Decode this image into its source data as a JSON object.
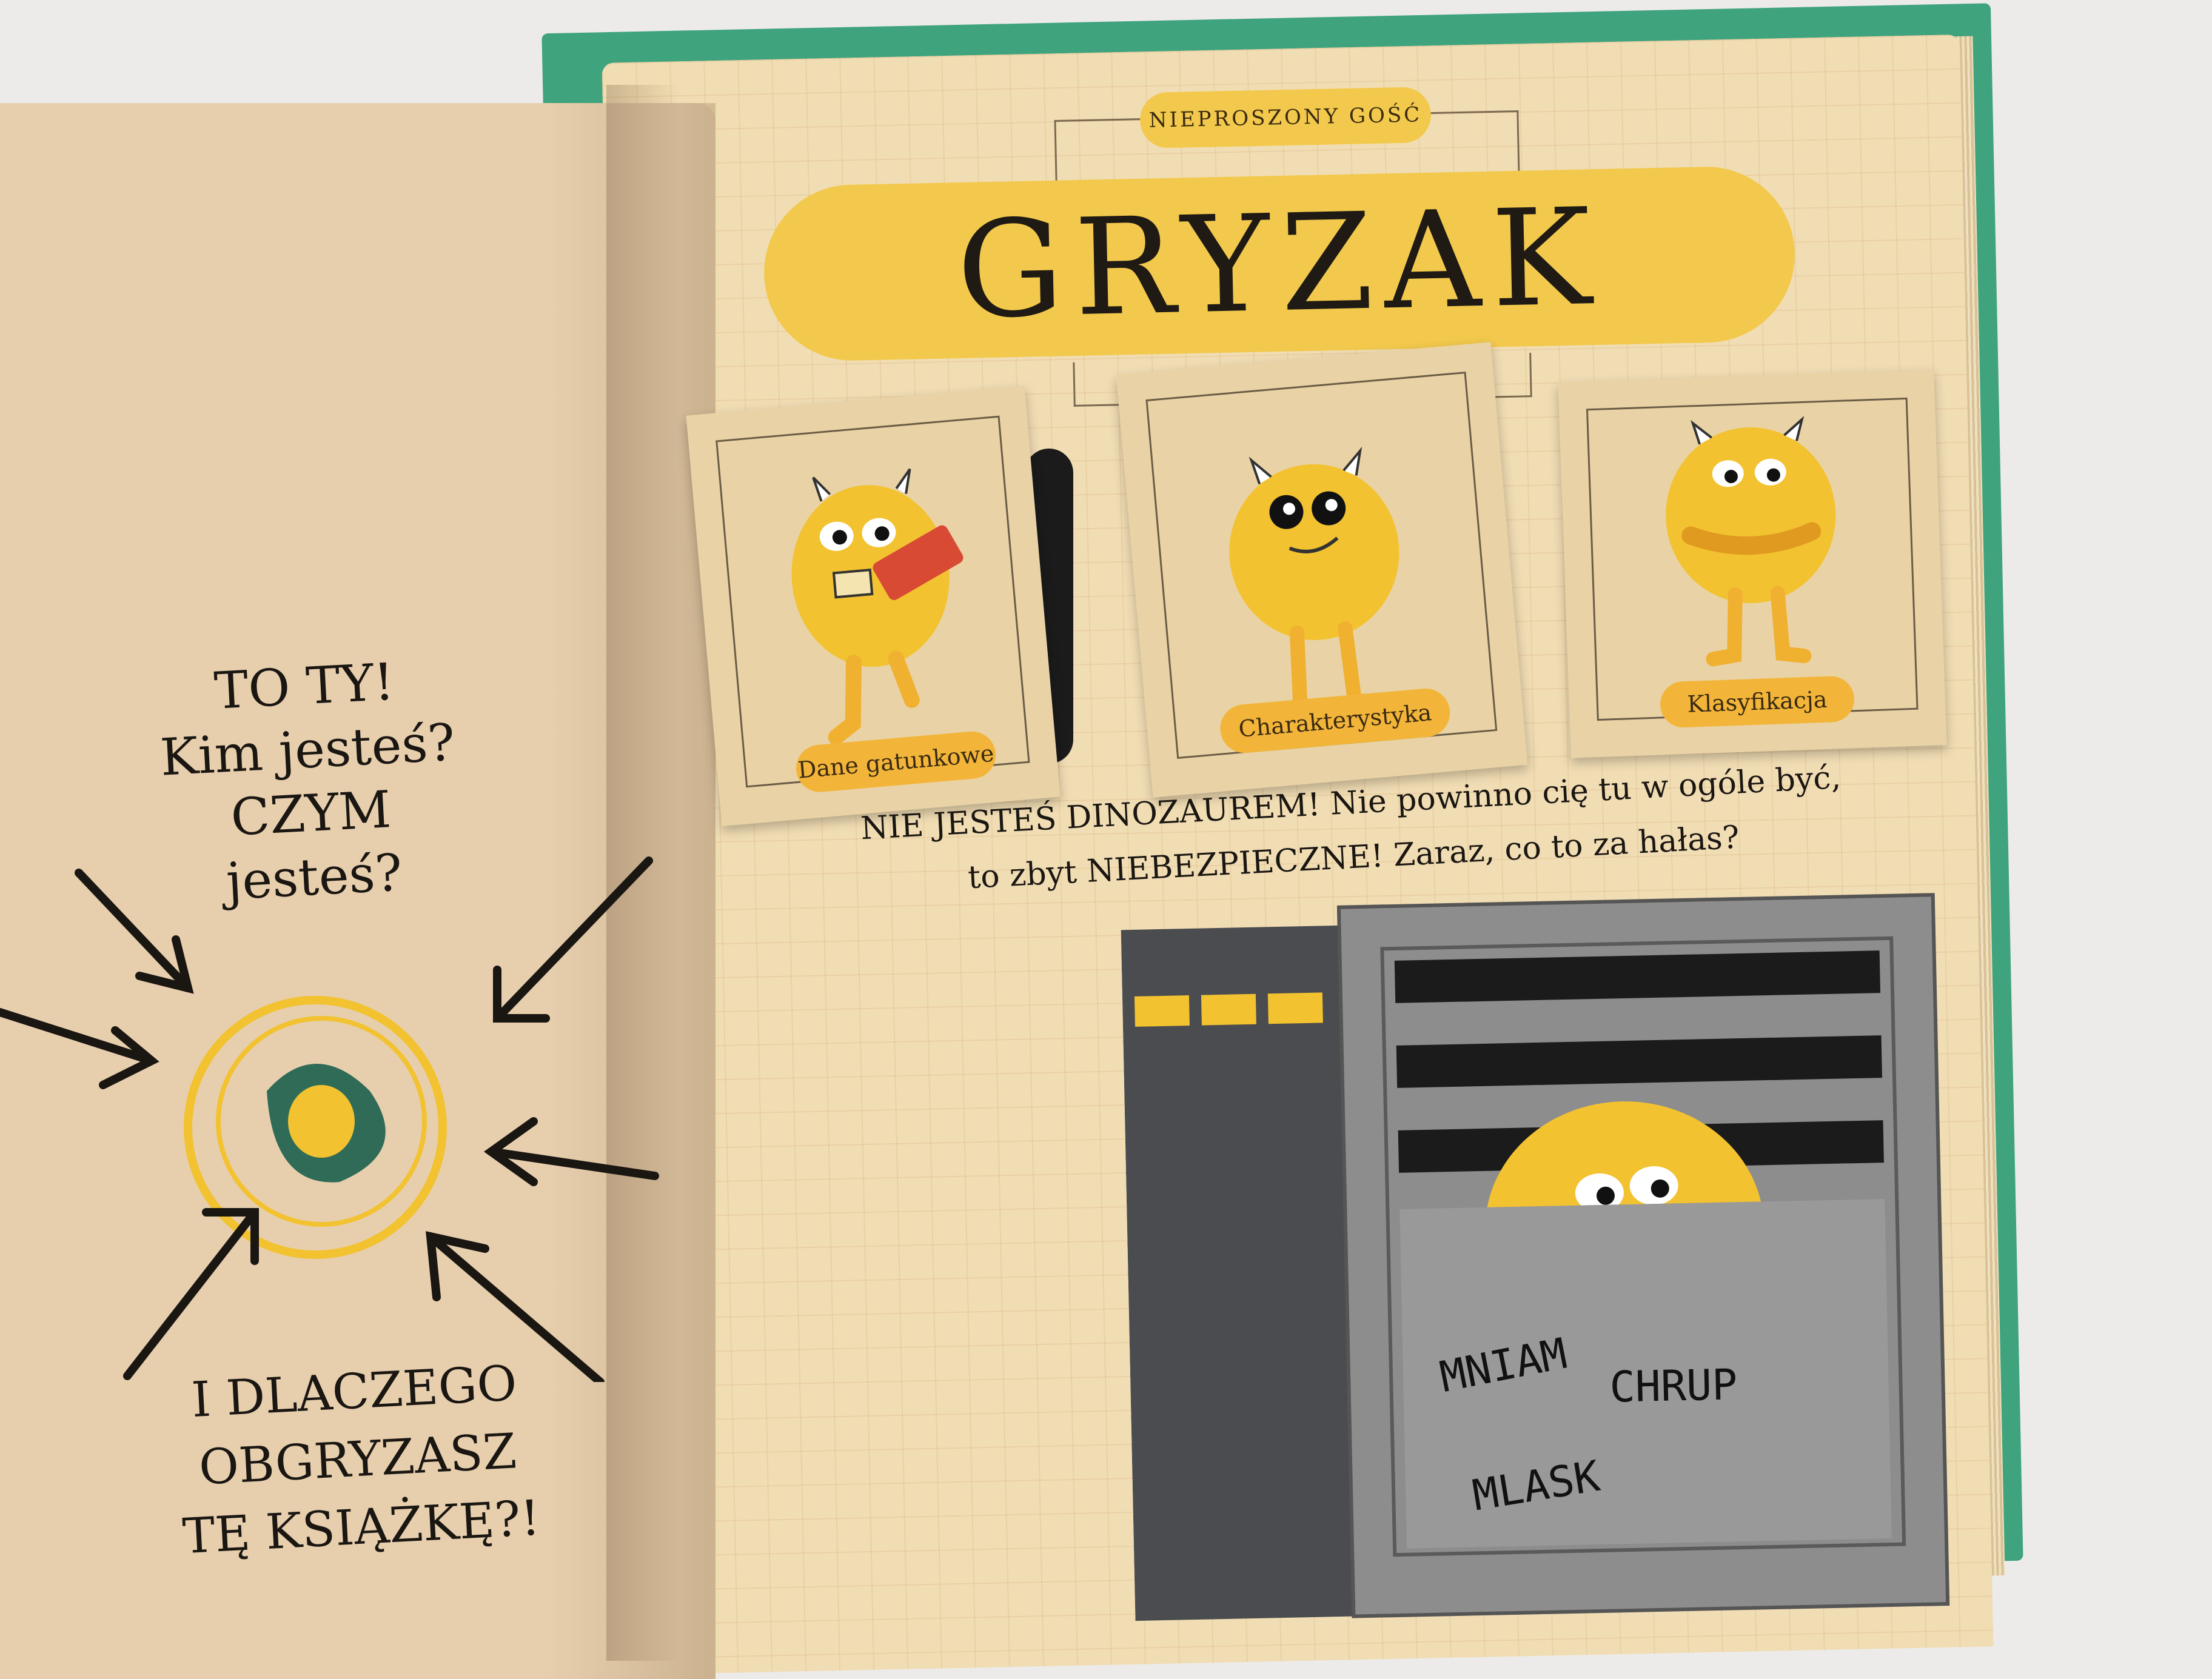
{
  "left_page": {
    "line1": "TO TY!",
    "line2": "Kim jesteś?",
    "line3": "CZYM jesteś?",
    "question1": "I DLACZEGO",
    "question2": "OBGRYZASZ",
    "question3": "TĘ KSIĄŻKĘ?!"
  },
  "right_page": {
    "kicker": "NIEPROSZONY GOŚĆ",
    "title": "GRYZAK",
    "flaps": [
      "Dane gatunkowe",
      "Charakterystyka",
      "Klasyfikacja"
    ],
    "body_line1": "NIE JESTEŚ DINOZAUREM! Nie powinno cię tu w ogóle być,",
    "body_line2": "to zbyt NIEBEZPIECZNE! Zaraz, co to za hałas?",
    "sounds": [
      "MNIAM",
      "CHRUP",
      "MLASK"
    ]
  },
  "colors": {
    "yellow": "#f2c94c",
    "page": "#f1ddb4",
    "left_page": "#e7cfae",
    "cover": "#3fa37e",
    "metal": "#8d8d8d",
    "dark_metal": "#4a4c50"
  }
}
